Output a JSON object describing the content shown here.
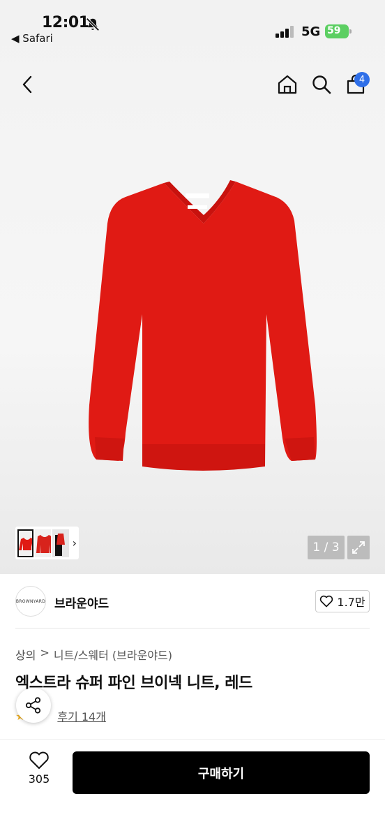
{
  "status_bar": {
    "time": "12:01",
    "back_app": "◀ Safari",
    "network": "5G",
    "battery": "59"
  },
  "nav": {
    "cart_count": "4",
    "icons": [
      "chevron-left-icon",
      "home-icon",
      "search-icon",
      "shopping-bag-icon"
    ]
  },
  "gallery": {
    "page_indicator": "1 / 3",
    "product_color": "#e01a14"
  },
  "brand": {
    "logo_text": "BROWNYARD",
    "name": "브라운야드",
    "likes": "1.7만"
  },
  "breadcrumb": {
    "category": "상의",
    "separator": ">",
    "subcategory": "니트/스웨터 (브라운야드)"
  },
  "product": {
    "title": "엑스트라 슈퍼 파인 브이넥 니트, 레드",
    "reviews": "후기 14개"
  },
  "bottom_bar": {
    "wish_count": "305",
    "buy_label": "구매하기"
  }
}
